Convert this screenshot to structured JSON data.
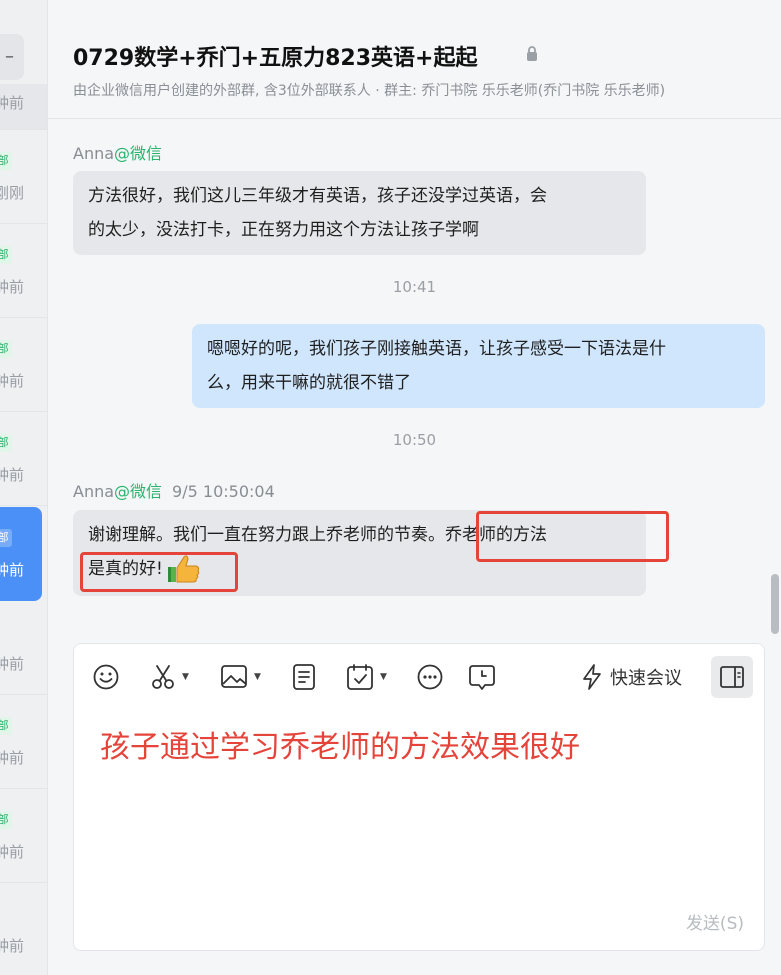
{
  "header": {
    "title": "0729数学+乔门+五原力823英语+起起",
    "subtitle": "由企业微信用户创建的外部群, 含3位外部联系人 · 群主: 乔门书院 乐乐老师(乔门书院 乐乐老师)"
  },
  "sidebar": {
    "items": [
      {
        "tag": "",
        "time": "钟前"
      },
      {
        "tag": "部",
        "time": "刚刚"
      },
      {
        "tag": "部",
        "time": "钟前"
      },
      {
        "tag": "部",
        "time": "钟前"
      },
      {
        "tag": "部",
        "time": "钟前"
      },
      {
        "tag": "部",
        "time": "钟前"
      },
      {
        "tag": "",
        "time": "钟前"
      },
      {
        "tag": "部",
        "time": "钟前"
      },
      {
        "tag": "部",
        "time": "钟前"
      },
      {
        "tag": "",
        "time": "钟前"
      }
    ]
  },
  "messages": {
    "m1": {
      "sender": "Anna",
      "source": "@微信",
      "text_line1": "方法很好，我们这儿三年级才有英语，孩子还没学过英语，会",
      "text_line2": "的太少，没法打卡，正在努力用这个方法让孩子学啊"
    },
    "time1": "10:41",
    "m2": {
      "text_line1": "嗯嗯好的呢，我们孩子刚接触英语，让孩子感受一下语法是什",
      "text_line2": "么，用来干嘛的就很不错了"
    },
    "time2": "10:50",
    "m3": {
      "sender": "Anna",
      "source": "@微信",
      "timestamp": "9/5 10:50:04",
      "text_line1": "谢谢理解。我们一直在努力跟上乔老师的节奏。乔老师的方法",
      "text_line2": "是真的好!"
    }
  },
  "composer": {
    "quick_meeting": "快速会议",
    "text": "孩子通过学习乔老师的方法效果很好",
    "send": "发送(S)"
  },
  "colors": {
    "accent": "#4a90f6",
    "wechat_green": "#29b36e",
    "highlight_red": "#e5443b",
    "my_bubble": "#cfe6fd"
  }
}
